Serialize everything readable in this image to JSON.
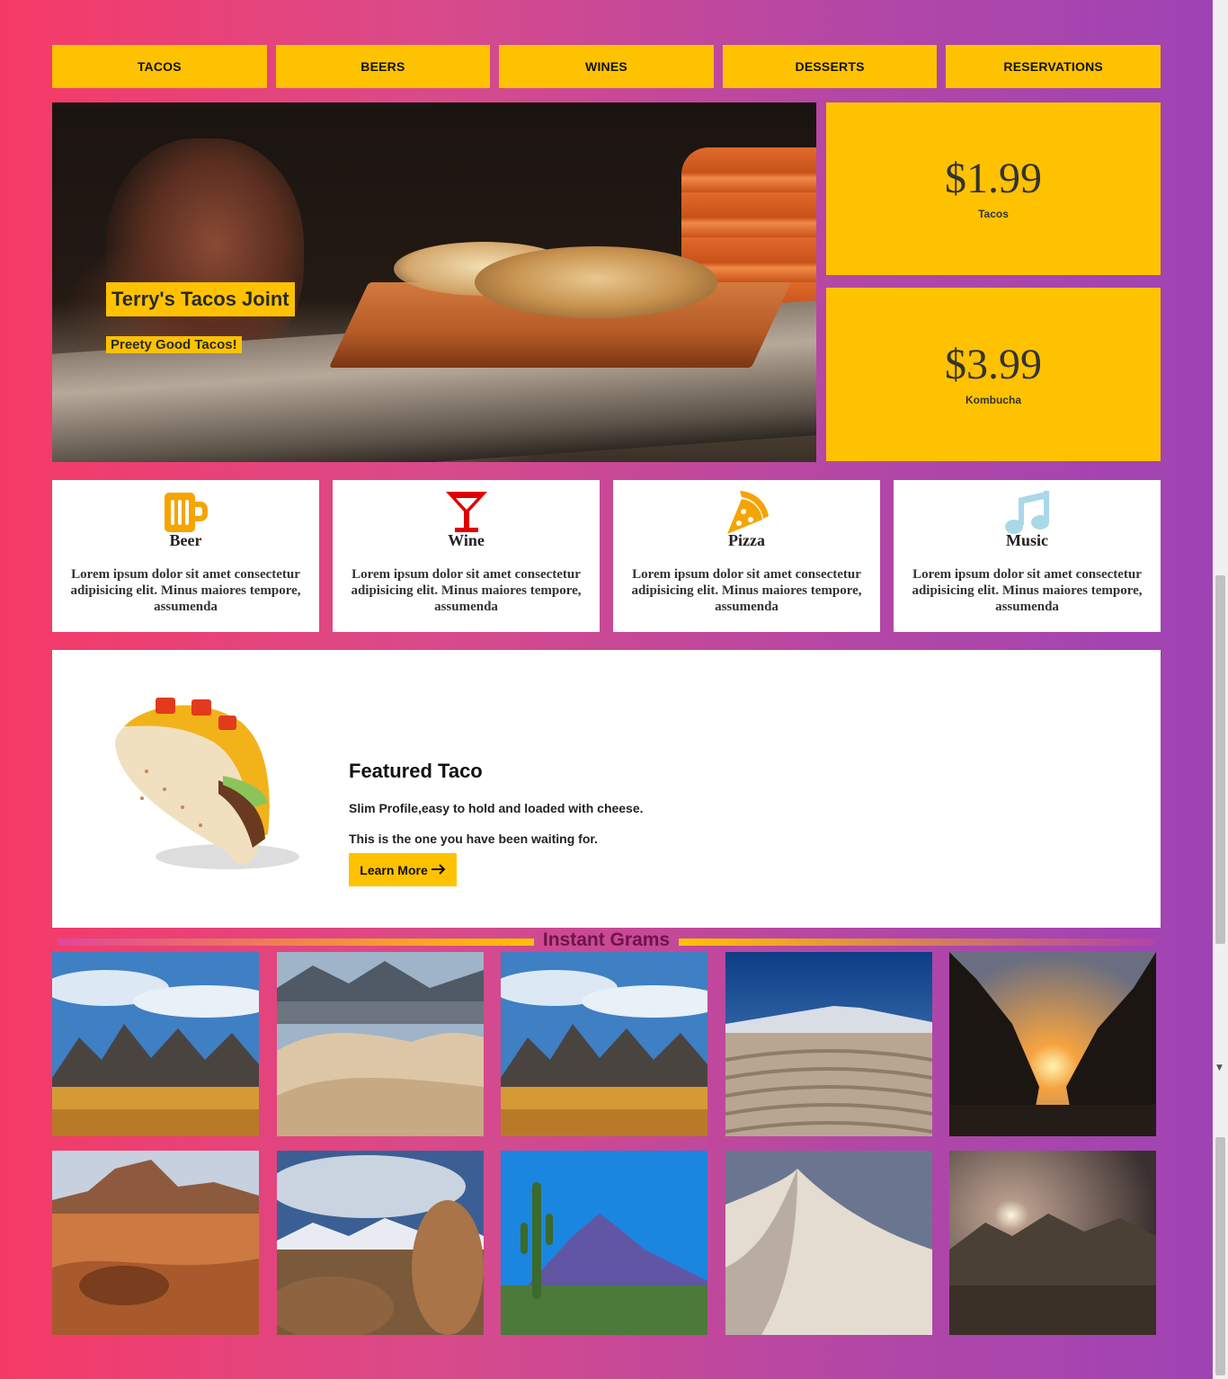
{
  "nav": {
    "items": [
      "TACOS",
      "BEERS",
      "WINES",
      "DESSERTS",
      "RESERVATIONS"
    ]
  },
  "hero": {
    "title": "Terry's Tacos Joint",
    "subtitle": "Preety Good Tacos!"
  },
  "prices": [
    {
      "value": "$1.99",
      "label": "Tacos"
    },
    {
      "value": "$3.99",
      "label": "Kombucha"
    }
  ],
  "features": [
    {
      "title": "Beer",
      "icon": "beer-mug-icon",
      "color": "#f5a400",
      "text": "Lorem ipsum dolor sit amet consectetur adipisicing elit. Minus maiores tempore, assumenda"
    },
    {
      "title": "Wine",
      "icon": "cocktail-glass-icon",
      "color": "#e00000",
      "text": "Lorem ipsum dolor sit amet consectetur adipisicing elit. Minus maiores tempore, assumenda"
    },
    {
      "title": "Pizza",
      "icon": "pizza-slice-icon",
      "color": "#f5a400",
      "text": "Lorem ipsum dolor sit amet consectetur adipisicing elit. Minus maiores tempore, assumenda"
    },
    {
      "title": "Music",
      "icon": "music-note-icon",
      "color": "#a9d8e8",
      "text": "Lorem ipsum dolor sit amet consectetur adipisicing elit. Minus maiores tempore, assumenda"
    }
  ],
  "featured": {
    "title": "Featured Taco",
    "line1": "Slim Profile,easy to hold and loaded with cheese.",
    "line2": "This is the one you have been waiting for.",
    "button_label": "Learn More"
  },
  "grams": {
    "title": "Instant Grams",
    "tiles": [
      "mountains-savanna",
      "desert-dunes-mountains",
      "mountains-savanna",
      "sand-ripples-snowy-peak",
      "canyon-sunset",
      "red-desert-rocks",
      "rocky-boulders-sky",
      "saguaro-cactus-mountain",
      "white-sand-dune",
      "dark-mountain-sun"
    ]
  },
  "colors": {
    "accent": "#ffc200",
    "gradient_start": "#f63a67",
    "gradient_end": "#9e43b5"
  }
}
